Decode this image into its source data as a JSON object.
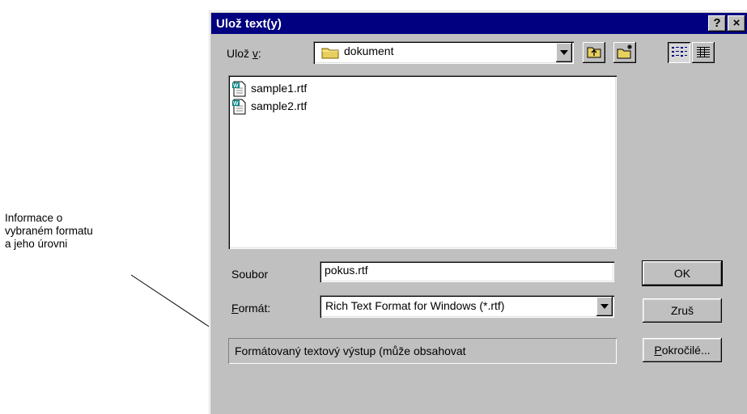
{
  "annotation": {
    "lines": [
      "Informace o",
      "vybraném formatu",
      "a jeho úrovni"
    ]
  },
  "dialog": {
    "title": "Ulož text(y)",
    "help_label": "?",
    "close_label": "×",
    "save_in": {
      "label_prefix": "Ulož ",
      "label_key": "v",
      "label_suffix": ":",
      "value": "dokument"
    },
    "files": [
      "sample1.rtf",
      "sample2.rtf"
    ],
    "filename": {
      "label": "Soubor",
      "value": "pokus.rtf"
    },
    "format": {
      "label_key": "F",
      "label_rest": "ormát:",
      "value": "Rich Text Format for Windows (*.rtf)"
    },
    "description": "Formátovaný textový výstup (může obsahovat",
    "buttons": {
      "ok": "OK",
      "cancel": "Zruš",
      "advanced_key": "P",
      "advanced_rest": "okročilé..."
    }
  },
  "colors": {
    "title_bg": "#000080",
    "face": "#c0c0c0",
    "folder": "#e8d060"
  },
  "icons": [
    "folder-icon",
    "up-folder-icon",
    "new-folder-icon",
    "list-view-icon",
    "details-view-icon",
    "rtf-file-icon",
    "dropdown-arrow-icon"
  ]
}
